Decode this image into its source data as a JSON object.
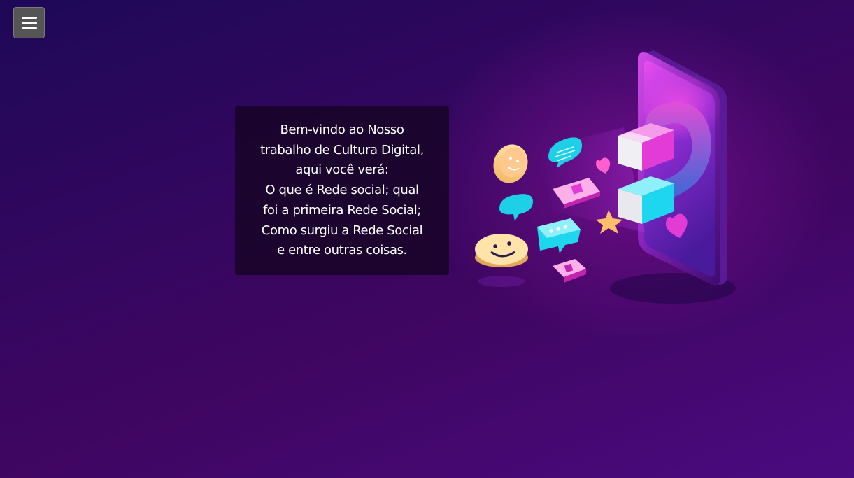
{
  "menu": {
    "icon": "hamburger-menu-icon"
  },
  "welcome": {
    "lines": [
      "Bem-vindo ao Nosso",
      "trabalho de Cultura Digital,",
      "aqui você verá:",
      "O que é Rede social; qual",
      "foi a primeira Rede Social;",
      "Como surgiu a Rede Social",
      "e entre outras coisas."
    ]
  },
  "illustration": {
    "description_icon": "phone-magnet-social-media-icon"
  },
  "colors": {
    "background_start": "#1e0857",
    "background_end": "#4a0a80",
    "box_background": "#180528",
    "menu_button": "#555555",
    "accent_pink": "#e23bd6",
    "accent_cyan": "#1ed7ee"
  }
}
